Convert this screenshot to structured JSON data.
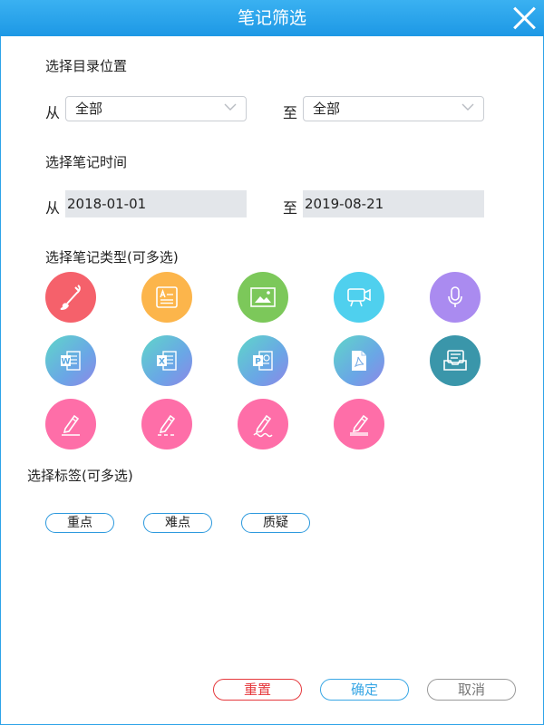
{
  "window": {
    "title": "笔记筛选"
  },
  "directory": {
    "label": "选择目录位置",
    "from_prefix": "从",
    "to_prefix": "至",
    "from_value": "全部",
    "to_value": "全部"
  },
  "time": {
    "label": "选择笔记时间",
    "from_prefix": "从",
    "to_prefix": "至",
    "from_date": "2018-01-01",
    "to_date": "2019-08-21"
  },
  "types": {
    "label": "选择笔记类型(可多选)",
    "icons": [
      "paintbrush-icon",
      "text-card-icon",
      "image-icon",
      "video-icon",
      "microphone-icon",
      "word-doc-icon",
      "excel-doc-icon",
      "powerpoint-doc-icon",
      "pdf-doc-icon",
      "inbox-icon",
      "pen-underline-icon",
      "pen-dashed-underline-icon",
      "pen-wavy-underline-icon",
      "highlighter-icon"
    ]
  },
  "tags": {
    "label": "选择标签(可多选)",
    "items": [
      "重点",
      "难点",
      "质疑"
    ]
  },
  "buttons": {
    "reset": "重置",
    "ok": "确定",
    "cancel": "取消"
  },
  "colors": {
    "titlebar": "#1d98e5",
    "reset": "#e5393d",
    "ok": "#39a7e5",
    "cancel": "#9a9a9a",
    "tag_border": "#2a98dd"
  }
}
